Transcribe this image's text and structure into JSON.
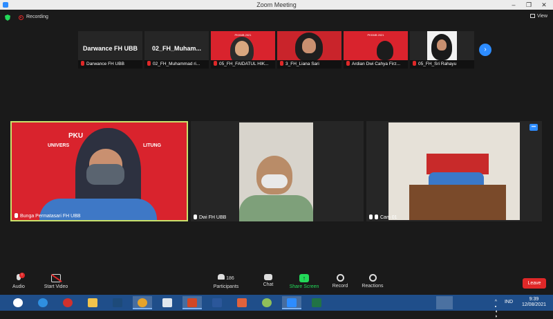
{
  "window": {
    "title": "Zoom Meeting"
  },
  "topbar": {
    "recording_label": "Recording",
    "view_label": "View"
  },
  "thumbnails": [
    {
      "name": "Darwance FH UBB",
      "display": "Darwance FH UBB"
    },
    {
      "name": "02_FH_Muhammad ri...",
      "display": "02_FH_Muham..."
    },
    {
      "name": "05_FH_FAIDATUL HIK..."
    },
    {
      "name": "3_FH_Liana Sari"
    },
    {
      "name": "Ardian Dwi Cahya Firz..."
    },
    {
      "name": "05_FH_Sri Rahayu"
    }
  ],
  "poster_text": "PKKMB 2021",
  "tiles": [
    {
      "name": "Bunga Permatasari FH UBB",
      "banner": "PKU",
      "banner2": "UNIVERS",
      "banner3": "LITUNG"
    },
    {
      "name": "Dwi FH UBB"
    },
    {
      "name": "Cam 01"
    }
  ],
  "toolbar": {
    "audio": "Audio",
    "video": "Start Video",
    "participants": "Participants",
    "participants_count": "186",
    "chat": "Chat",
    "share": "Share Screen",
    "record": "Record",
    "reactions": "Reactions",
    "leave": "Leave"
  },
  "taskbar": {
    "lang": "IND",
    "time": "9:39",
    "date": "12/08/2021"
  },
  "colors": {
    "accent": "#2d8cff",
    "share_green": "#23d959",
    "leave_red": "#e02828",
    "active_speaker": "#c9e26a"
  }
}
